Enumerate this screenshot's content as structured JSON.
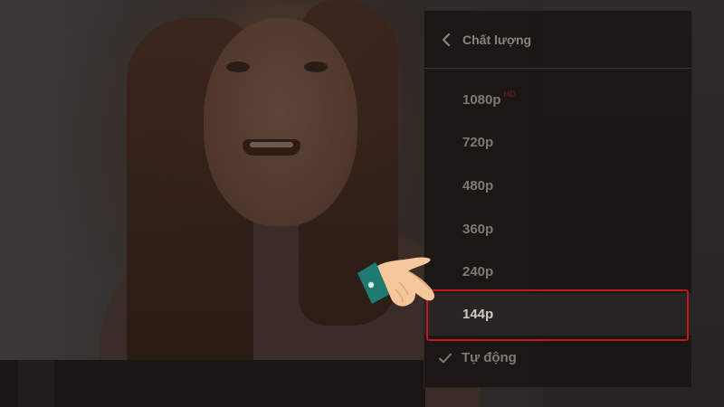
{
  "menu": {
    "title": "Chất lượng",
    "options": [
      {
        "label": "1080p",
        "badge": "HD"
      },
      {
        "label": "720p"
      },
      {
        "label": "480p"
      },
      {
        "label": "360p"
      },
      {
        "label": "240p"
      },
      {
        "label": "144p"
      },
      {
        "label": "Tự động",
        "selected": true
      }
    ]
  },
  "colors": {
    "highlight": "#c0181c",
    "menu_bg": "#1a1614",
    "hand_skin": "#f5c79a",
    "sleeve": "#1f7a72"
  },
  "icons": {
    "back": "chevron-left-icon",
    "check": "check-icon",
    "pointer": "pointing-hand-icon"
  }
}
